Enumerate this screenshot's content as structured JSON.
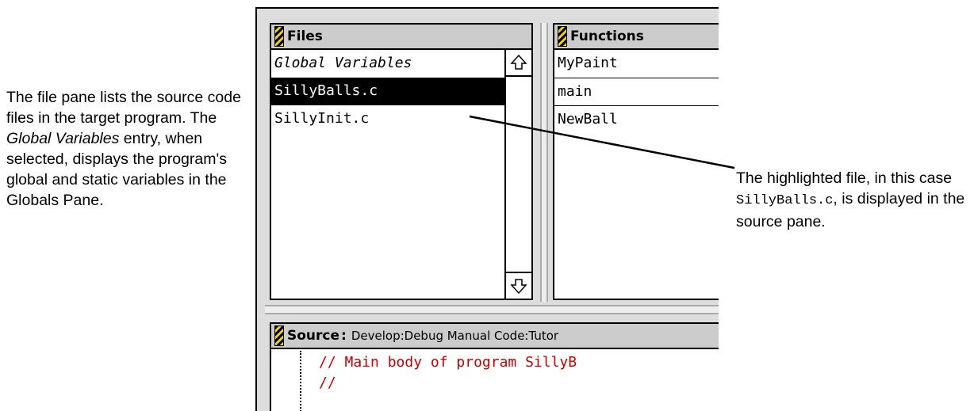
{
  "captions": {
    "left": {
      "part1": "The file pane lists the source code files in the target program. The ",
      "italic": "Global Variables",
      "part2": " entry, when selected, displays the program's global and static variables in the Globals Pane."
    },
    "right": {
      "part1": "The highlighted file, in this case ",
      "code": "SillyBalls.c",
      "part2": ", is displayed in the source pane."
    }
  },
  "files_pane": {
    "title": "Files",
    "items": [
      {
        "label": "Global Variables",
        "italic": true,
        "selected": false
      },
      {
        "label": "SillyBalls.c",
        "italic": false,
        "selected": true
      },
      {
        "label": "SillyInit.c",
        "italic": false,
        "selected": false
      }
    ]
  },
  "functions_pane": {
    "title": "Functions",
    "items": [
      "MyPaint",
      "main",
      "NewBall"
    ]
  },
  "source_pane": {
    "title": "Source",
    "path": "Develop:Debug Manual Code:Tutor",
    "lines": [
      "//    Main body of program SillyB",
      "//"
    ]
  },
  "colors": {
    "selection": "#000000",
    "comment": "#cc0000",
    "grip": "#f5d400"
  }
}
